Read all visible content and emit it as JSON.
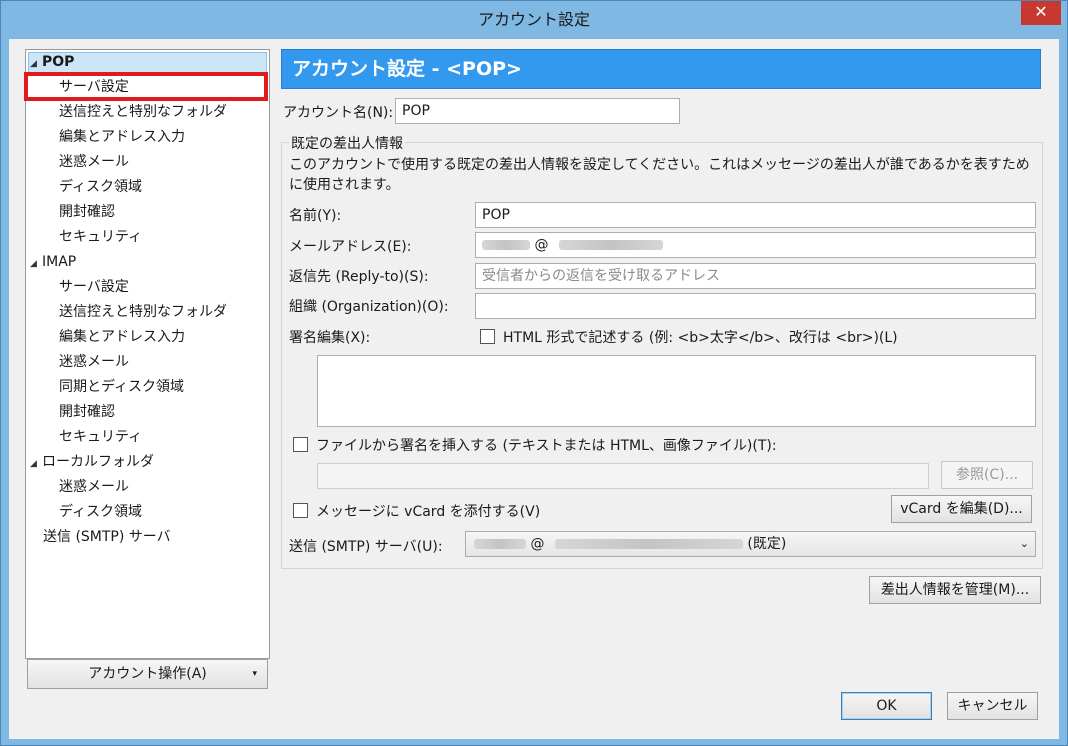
{
  "window": {
    "title": "アカウント設定",
    "close_glyph": "✕"
  },
  "tree": {
    "items": [
      {
        "label": "POP",
        "arrow": "◢"
      },
      {
        "label": "サーバ設定"
      },
      {
        "label": "送信控えと特別なフォルダ"
      },
      {
        "label": "編集とアドレス入力"
      },
      {
        "label": "迷惑メール"
      },
      {
        "label": "ディスク領域"
      },
      {
        "label": "開封確認"
      },
      {
        "label": "セキュリティ"
      },
      {
        "label": "IMAP",
        "arrow": "◢"
      },
      {
        "label": "サーバ設定"
      },
      {
        "label": "送信控えと特別なフォルダ"
      },
      {
        "label": "編集とアドレス入力"
      },
      {
        "label": "迷惑メール"
      },
      {
        "label": "同期とディスク領域"
      },
      {
        "label": "開封確認"
      },
      {
        "label": "セキュリティ"
      },
      {
        "label": "ローカルフォルダ",
        "arrow": "◢"
      },
      {
        "label": "迷惑メール"
      },
      {
        "label": "ディスク領域"
      },
      {
        "label": "送信 (SMTP) サーバ"
      }
    ],
    "account_ops_label": "アカウント操作(A)",
    "account_ops_caret": "▾"
  },
  "main": {
    "header_title": "アカウント設定 - <POP>",
    "account_name_label": "アカウント名(N):",
    "account_name_value": "POP",
    "identity_legend": "既定の差出人情報",
    "identity_desc": "このアカウントで使用する既定の差出人情報を設定してください。これはメッセージの差出人が誰であるかを表すために使用されます。",
    "name_label": "名前(Y):",
    "name_value": "POP",
    "email_label": "メールアドレス(E):",
    "email_at": "@",
    "reply_label": "返信先 (Reply-to)(S):",
    "reply_placeholder": "受信者からの返信を受け取るアドレス",
    "org_label": "組織 (Organization)(O):",
    "org_value": "",
    "signature_label": "署名編集(X):",
    "html_checkbox_label": "HTML 形式で記述する (例: <b>太字</b>、改行は <br>)(L)",
    "signature_text": "",
    "file_sig_label": "ファイルから署名を挿入する (テキストまたは HTML、画像ファイル)(T):",
    "file_path_value": "",
    "browse_label": "参照(C)...",
    "vcard_label": "メッセージに vCard を添付する(V)",
    "vcard_edit_label": "vCard を編集(D)...",
    "smtp_label": "送信 (SMTP) サーバ(U):",
    "smtp_at": "@",
    "smtp_default_suffix": "(既定)",
    "smtp_chevron": "⌄",
    "manage_identities_label": "差出人情報を管理(M)..."
  },
  "footer": {
    "ok_label": "OK",
    "cancel_label": "キャンセル"
  }
}
